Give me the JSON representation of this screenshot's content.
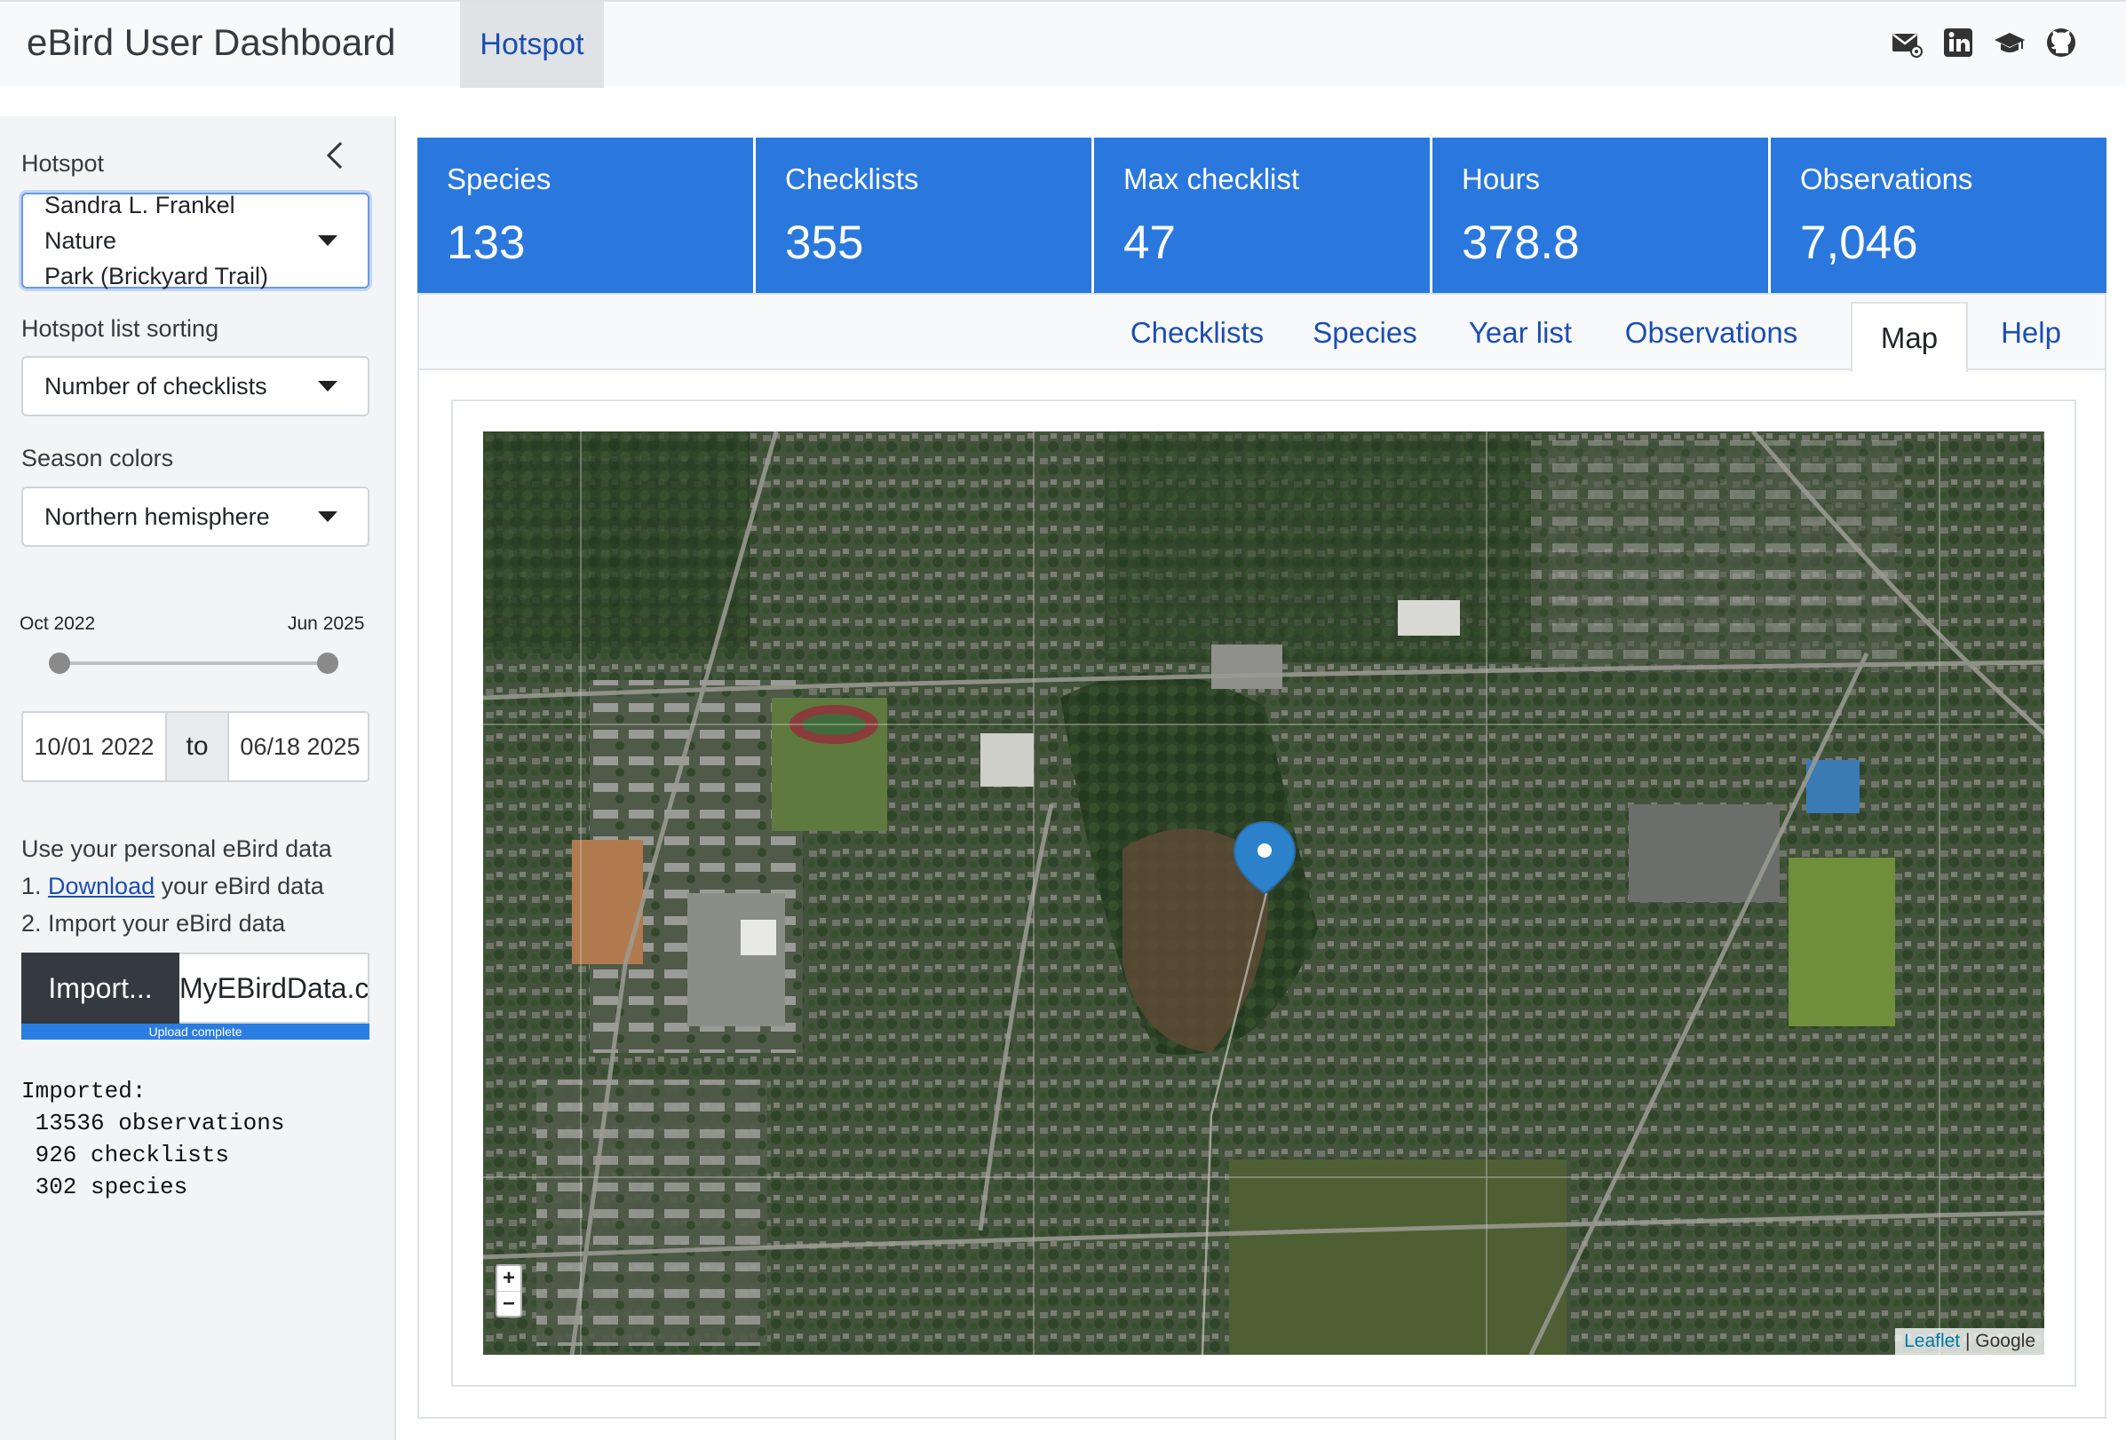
{
  "navbar": {
    "title": "eBird User Dashboard",
    "tab": "Hotspot",
    "icons": [
      "email-icon",
      "linkedin-icon",
      "graduation-cap-icon",
      "github-icon"
    ]
  },
  "sidebar": {
    "hotspot_label": "Hotspot",
    "hotspot_value_line1": "Sandra L. Frankel Nature",
    "hotspot_value_line2": "Park (Brickyard Trail)",
    "sorting_label": "Hotspot list sorting",
    "sorting_value": "Number of checklists",
    "season_label": "Season colors",
    "season_value": "Northern hemisphere",
    "range_min_label": "Oct 2022",
    "range_max_label": "Jun 2025",
    "date_start": "10/01 2022",
    "date_sep": "to",
    "date_end": "06/18 2025",
    "help_title": "Use your personal eBird data",
    "step1_prefix": "1. ",
    "step1_link": "Download",
    "step1_suffix": " your eBird data",
    "step2": "2. Import your eBird data",
    "import_button": "Import...",
    "file_name": "MyEBirdData.csv",
    "upload_status": "Upload complete",
    "imported_title": "Imported:",
    "imported_observations": " 13536 observations",
    "imported_checklists": " 926 checklists",
    "imported_species": " 302 species"
  },
  "stats": [
    {
      "title": "Species",
      "value": "133"
    },
    {
      "title": "Checklists",
      "value": "355"
    },
    {
      "title": "Max checklist",
      "value": "47"
    },
    {
      "title": "Hours",
      "value": "378.8"
    },
    {
      "title": "Observations",
      "value": "7,046"
    }
  ],
  "tabs": [
    "Checklists",
    "Species",
    "Year list",
    "Observations",
    "Map",
    "Help"
  ],
  "active_tab": "Map",
  "map": {
    "zoom_in": "+",
    "zoom_out": "−",
    "attribution_link": "Leaflet",
    "attribution_sep": " | ",
    "attribution_source": "Google"
  },
  "colors": {
    "accent": "#2a78dd",
    "link": "#1b4db3",
    "marker": "#2b82cb"
  }
}
